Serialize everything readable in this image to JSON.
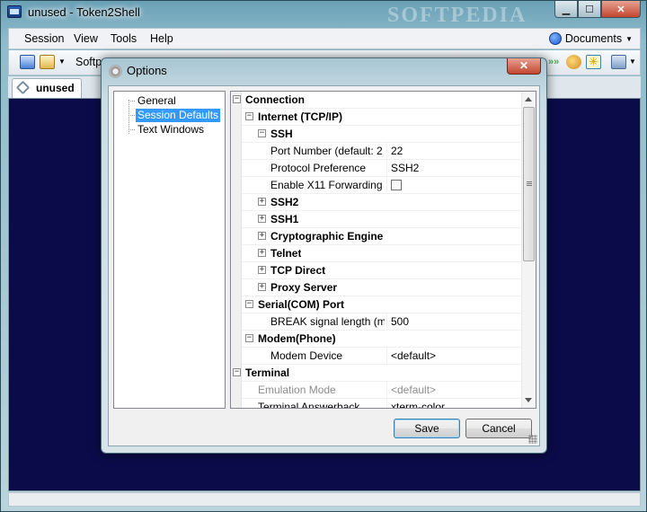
{
  "window": {
    "title": "unused - Token2Shell",
    "watermark": "SOFTPEDIA"
  },
  "menu": {
    "items": [
      "Session",
      "View",
      "Tools",
      "Help"
    ],
    "documents": "Documents"
  },
  "toolbar": {
    "session_label": "Softp"
  },
  "tab": {
    "label": "unused"
  },
  "dialog": {
    "title": "Options",
    "close": "✕",
    "nav": [
      {
        "label": "General",
        "selected": false
      },
      {
        "label": "Session Defaults",
        "selected": true
      },
      {
        "label": "Text Windows",
        "selected": false
      }
    ],
    "properties": [
      {
        "name": "Connection",
        "value": "",
        "level": 0,
        "bold": true,
        "toggle": "-",
        "dim": false
      },
      {
        "name": "Internet (TCP/IP)",
        "value": "",
        "level": 1,
        "bold": true,
        "toggle": "-",
        "dim": false
      },
      {
        "name": "SSH",
        "value": "",
        "level": 2,
        "bold": true,
        "toggle": "-",
        "dim": false
      },
      {
        "name": "Port Number (default: 2",
        "value": "22",
        "level": 3,
        "bold": false,
        "toggle": "",
        "dim": false
      },
      {
        "name": "Protocol Preference",
        "value": "SSH2",
        "level": 3,
        "bold": false,
        "toggle": "",
        "dim": false
      },
      {
        "name": "Enable X11 Forwarding",
        "value": "",
        "level": 3,
        "bold": false,
        "toggle": "",
        "dim": false,
        "checkbox": true
      },
      {
        "name": "SSH2",
        "value": "",
        "level": 3,
        "bold": true,
        "toggle": "+",
        "dim": false
      },
      {
        "name": "SSH1",
        "value": "",
        "level": 3,
        "bold": true,
        "toggle": "+",
        "dim": false
      },
      {
        "name": "Cryptographic Engine",
        "value": "",
        "level": 3,
        "bold": true,
        "toggle": "+",
        "dim": false
      },
      {
        "name": "Telnet",
        "value": "",
        "level": 2,
        "bold": true,
        "toggle": "+",
        "dim": false
      },
      {
        "name": "TCP Direct",
        "value": "",
        "level": 2,
        "bold": true,
        "toggle": "+",
        "dim": false
      },
      {
        "name": "Proxy Server",
        "value": "",
        "level": 2,
        "bold": true,
        "toggle": "+",
        "dim": false
      },
      {
        "name": "Serial(COM) Port",
        "value": "",
        "level": 1,
        "bold": true,
        "toggle": "-",
        "dim": false
      },
      {
        "name": "BREAK signal length (msec",
        "value": "500",
        "level": 2,
        "bold": false,
        "toggle": "",
        "dim": false
      },
      {
        "name": "Modem(Phone)",
        "value": "",
        "level": 1,
        "bold": true,
        "toggle": "-",
        "dim": false
      },
      {
        "name": "Modem Device",
        "value": "<default>",
        "level": 2,
        "bold": false,
        "toggle": "",
        "dim": false
      },
      {
        "name": "Terminal",
        "value": "",
        "level": 0,
        "bold": true,
        "toggle": "-",
        "dim": false
      },
      {
        "name": "Emulation Mode",
        "value": "<default>",
        "level": 1,
        "bold": false,
        "toggle": "",
        "dim": true
      },
      {
        "name": "Terminal Answerback",
        "value": "xterm-color",
        "level": 1,
        "bold": false,
        "toggle": "",
        "dim": false
      }
    ],
    "save_label": "Save",
    "cancel_label": "Cancel"
  },
  "colors": {
    "terminal_bg": "#0b0b4a",
    "selection": "#3399ff"
  }
}
